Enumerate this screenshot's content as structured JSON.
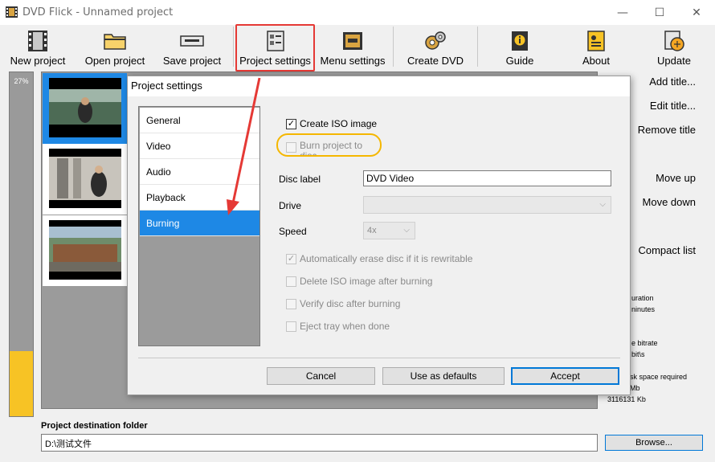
{
  "window": {
    "title": "DVD Flick - Unnamed project",
    "minimize": "—",
    "maximize": "☐",
    "close": "✕"
  },
  "toolbar": {
    "new_project": "New project",
    "open_project": "Open project",
    "save_project": "Save project",
    "project_settings": "Project settings",
    "menu_settings": "Menu settings",
    "create_dvd": "Create DVD",
    "guide": "Guide",
    "about": "About",
    "update": "Update"
  },
  "progress": {
    "label": "27%",
    "value": 0.19
  },
  "right_panel": {
    "add_title": "Add title...",
    "edit_title": "Edit title...",
    "remove_title": "Remove title",
    "move_up": "Move up",
    "move_down": "Move down",
    "compact_list": "Compact list",
    "stat_duration_label": "uration",
    "stat_duration_value": "ninutes",
    "stat_bitrate_label": "e bitrate",
    "stat_bitrate_value": "bit\\s",
    "stat_space_label": "sk space required",
    "stat_space_value": "Mb",
    "stat_space_kb": "3116131 Kb"
  },
  "destination": {
    "label": "Project destination folder",
    "value": "D:\\测试文件",
    "browse": "Browse..."
  },
  "dialog": {
    "title": "Project settings",
    "nav": [
      "General",
      "Video",
      "Audio",
      "Playback",
      "Burning"
    ],
    "create_iso": "Create ISO image",
    "burn_to_disc_line1": "Burn project to",
    "burn_to_disc_line2": "disc",
    "disc_label": "Disc label",
    "disc_label_value": "DVD Video",
    "drive": "Drive",
    "drive_value": "",
    "speed": "Speed",
    "speed_value": "4x",
    "auto_erase": "Automatically erase disc if it is rewritable",
    "delete_iso": "Delete ISO image after burning",
    "verify_disc": "Verify disc after burning",
    "eject_tray": "Eject tray when done",
    "cancel": "Cancel",
    "use_defaults": "Use as defaults",
    "accept": "Accept"
  },
  "colors": {
    "selection_blue": "#1e88e5",
    "highlight_red": "#e53935",
    "highlight_orange": "#f5b700",
    "progress_yellow": "#f7c325"
  }
}
